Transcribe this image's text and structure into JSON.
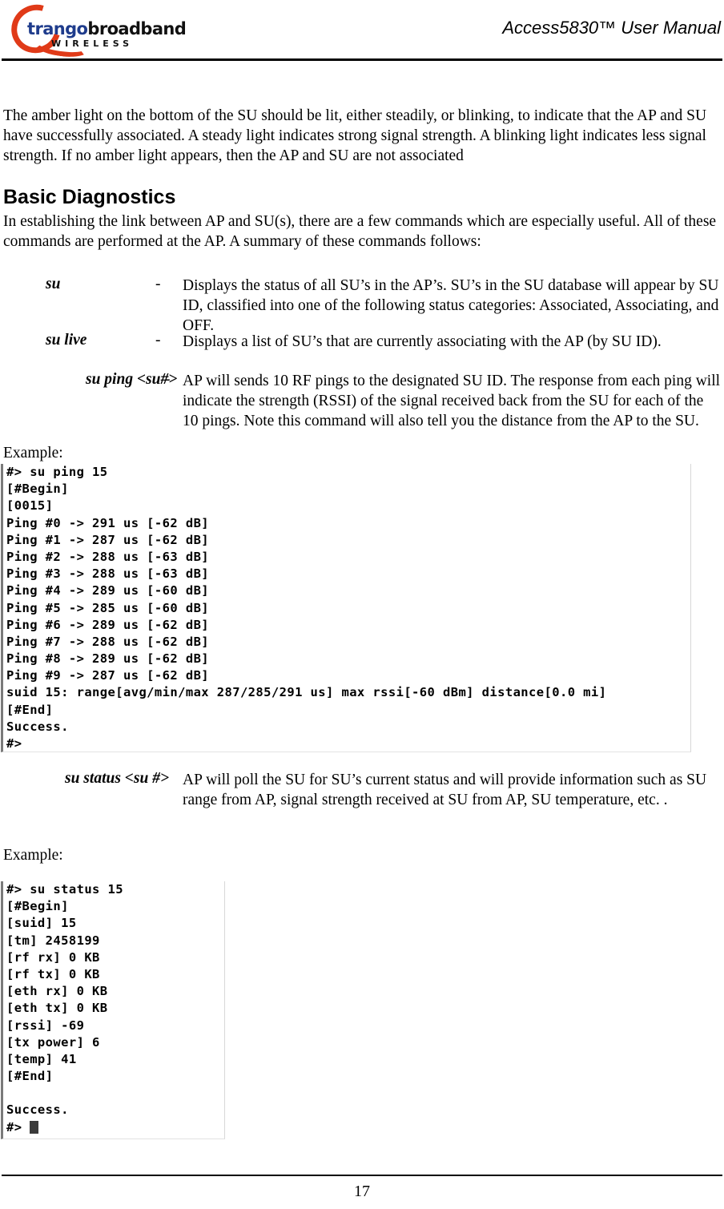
{
  "header": {
    "logo": {
      "word_part1": "trango",
      "word_part2": "broadband",
      "tagline": "WIRELESS",
      "brand_blue": "#1F3C8C",
      "brand_red": "#E03A18"
    },
    "title": "Access5830™ User Manual"
  },
  "body": {
    "intro_paragraph": "The amber light on the bottom of the SU should be lit, either steadily, or blinking, to indicate that the AP and SU have successfully associated.  A steady light indicates strong signal strength.  A blinking light indicates less signal strength.  If no amber light appears, then the AP and SU are not associated",
    "section_heading": "Basic Diagnostics",
    "section_paragraph": "In establishing the link between AP and SU(s), there are a few commands which are especially useful.  All of these commands are performed at the AP.  A summary of these commands follows:",
    "commands": [
      {
        "name": "su",
        "dash": "-",
        "description": "Displays the status of all SU’s in the AP’s.  SU’s in the SU database will appear by SU ID, classified into one of the following status categories:   Associated, Associating, and OFF."
      },
      {
        "name": "su live",
        "dash": "-",
        "description": "Displays a list of SU’s that are currently associating with the AP (by SU ID)."
      },
      {
        "name": "su ping <su#>",
        "dash": "-",
        "description": "AP will sends 10 RF pings to the designated SU ID.  The response from each ping will indicate the strength (RSSI) of the signal received back from the SU for each of the 10 pings.   Note this command will also tell you the distance from the AP to the SU."
      },
      {
        "name": "su status <su #>",
        "dash": "",
        "description": "AP will poll the SU for SU’s current status and will provide information such as SU range from AP, signal strength received at SU from AP, SU temperature, etc. ."
      }
    ],
    "example_label_1": "Example:",
    "example_label_2": "Example:"
  },
  "terminal_ping": {
    "lines": [
      "#> su ping 15",
      "[#Begin]",
      "[0015]",
      "Ping #0 -> 291 us [-62 dB]",
      "Ping #1 -> 287 us [-62 dB]",
      "Ping #2 -> 288 us [-63 dB]",
      "Ping #3 -> 288 us [-63 dB]",
      "Ping #4 -> 289 us [-60 dB]",
      "Ping #5 -> 285 us [-60 dB]",
      "Ping #6 -> 289 us [-62 dB]",
      "Ping #7 -> 288 us [-62 dB]",
      "Ping #8 -> 289 us [-62 dB]",
      "Ping #9 -> 287 us [-62 dB]",
      "suid 15: range[avg/min/max 287/285/291 us] max rssi[-60 dBm] distance[0.0 mi]",
      "[#End]",
      "Success.",
      "#>"
    ]
  },
  "terminal_status": {
    "lines": [
      "#> su status 15",
      "[#Begin]",
      "[suid] 15",
      "[tm] 2458199",
      "[rf rx] 0 KB",
      "[rf tx] 0 KB",
      "[eth rx] 0 KB",
      "[eth tx] 0 KB",
      "[rssi] -69",
      "[tx power] 6",
      "[temp] 41",
      "[#End]",
      "",
      "Success.",
      "#> "
    ]
  },
  "footer": {
    "page_number": "17"
  }
}
